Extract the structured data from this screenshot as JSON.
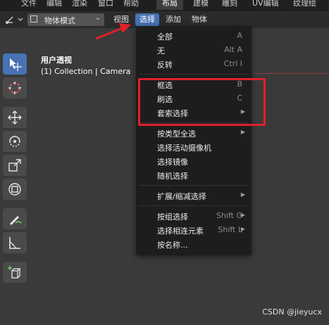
{
  "topbar": {
    "menus": [
      "文件",
      "编辑",
      "渲染",
      "窗口",
      "帮助"
    ],
    "workspaces": [
      "布局",
      "建模",
      "雕刻",
      "UV编辑",
      "纹理绘制"
    ],
    "active_workspace": "布局"
  },
  "header": {
    "mode": "物体模式",
    "menus": [
      "视图",
      "选择",
      "添加",
      "物体"
    ],
    "open_menu": "选择"
  },
  "viewport": {
    "title": "用户透视",
    "subtitle": "(1) Collection | Camera"
  },
  "select_menu": {
    "items": [
      {
        "label": "全部",
        "shortcut": "A"
      },
      {
        "label": "无",
        "shortcut": "Alt A"
      },
      {
        "label": "反转",
        "shortcut": "Ctrl I"
      },
      {
        "label": "框选",
        "shortcut": "B"
      },
      {
        "label": "刷选",
        "shortcut": "C"
      },
      {
        "label": "套索选择",
        "shortcut": ""
      },
      {
        "label": "按类型全选",
        "shortcut": ""
      },
      {
        "label": "选择活动摄像机",
        "shortcut": ""
      },
      {
        "label": "选择镜像",
        "shortcut": ""
      },
      {
        "label": "随机选择",
        "shortcut": ""
      },
      {
        "label": "扩展/缩减选择",
        "shortcut": ""
      },
      {
        "label": "按组选择",
        "shortcut": "Shift G"
      },
      {
        "label": "选择相连元素",
        "shortcut": "Shift L"
      },
      {
        "label": "按名称...",
        "shortcut": ""
      }
    ]
  },
  "tools": [
    "select-cursor-icon",
    "cursor-3d-icon",
    "move-icon",
    "rotate-icon",
    "scale-icon",
    "transform-icon",
    "annotate-icon",
    "measure-icon",
    "add-cube-icon"
  ],
  "watermark": "CSDN @jieyucx",
  "colors": {
    "accent": "#4772b3",
    "highlight_box": "#e0202a",
    "menu_bg": "#1d1d1d"
  }
}
